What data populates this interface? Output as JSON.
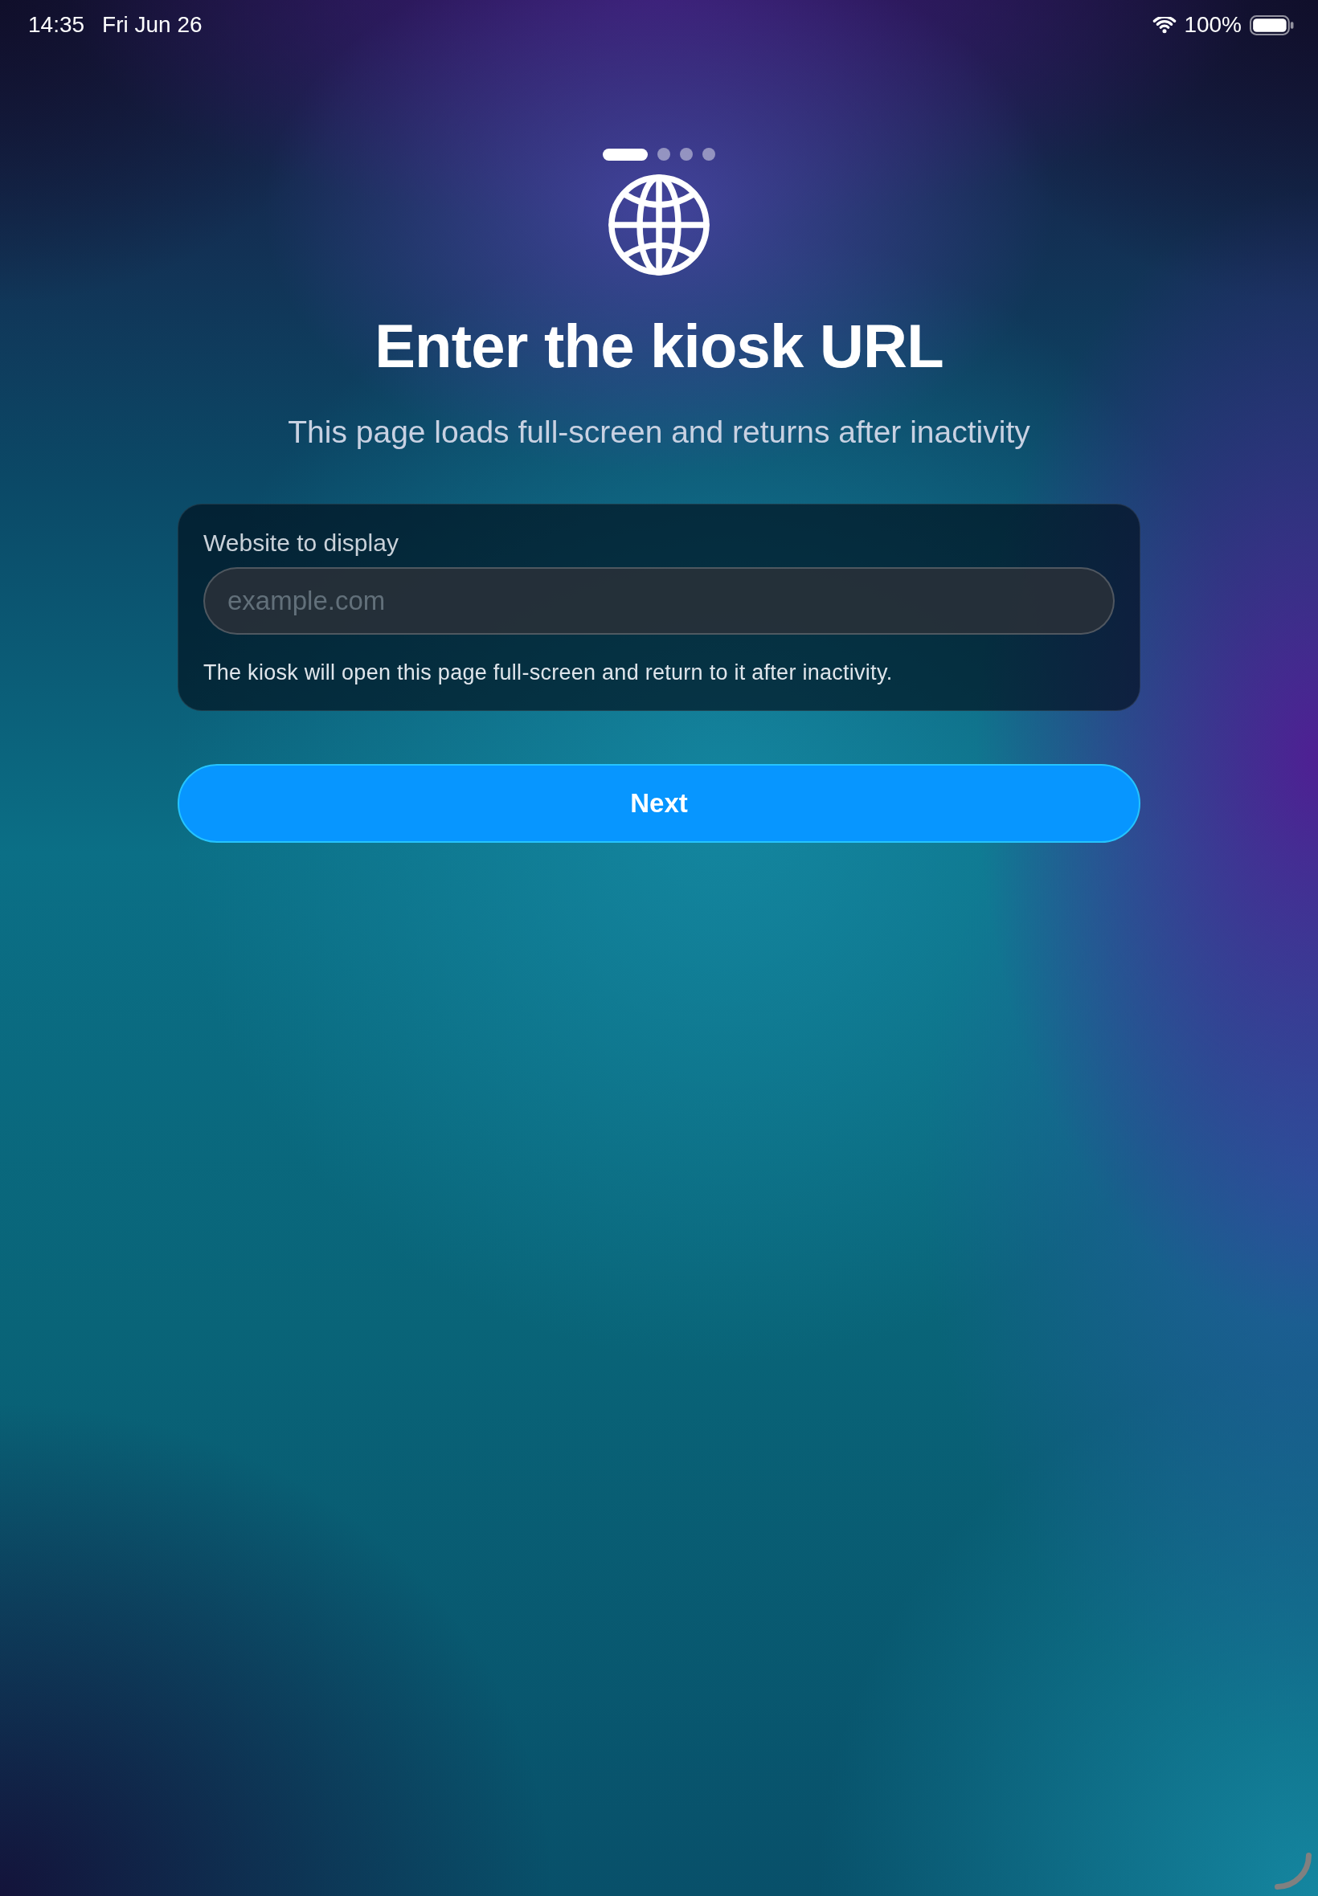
{
  "status_bar": {
    "time": "14:35",
    "date": "Fri Jun 26",
    "battery": "100%"
  },
  "page_indicator": [
    {
      "selected": true
    },
    {
      "selected": false
    },
    {
      "selected": false
    },
    {
      "selected": false
    }
  ],
  "title": "Enter the kiosk URL",
  "subtitle": "This page loads full-screen and returns after inactivity",
  "url_card": {
    "label": "Website to display",
    "field": {
      "placeholder": "example.com"
    },
    "hint": "The kiosk will open this page full-screen and return to it after inactivity."
  },
  "next_button": {
    "label": "Next"
  }
}
